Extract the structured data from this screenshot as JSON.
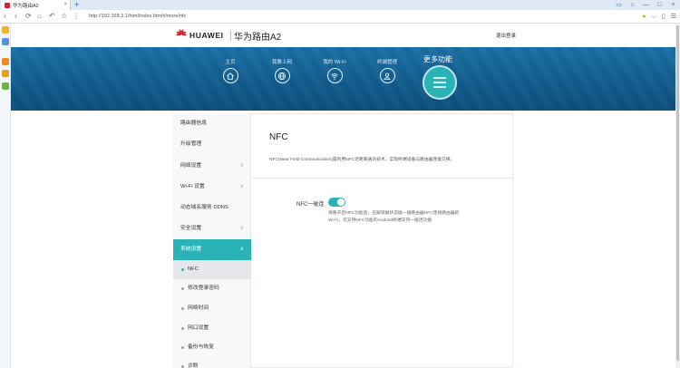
{
  "browser": {
    "tab_title": "华为路由A2",
    "tab_close": "×",
    "new_tab": "+",
    "url": "http://192.168.3.1/html/index.html#/more/nfc",
    "nav_back": "‹",
    "nav_forward": "›",
    "nav_refresh": "⟳",
    "nav_home": "⌂",
    "nav_undo": "↶",
    "nav_star": "☆",
    "nav_menu": "⋮",
    "win_controls": [
      "▭",
      "⌂",
      "—",
      "□",
      "×"
    ],
    "addr_icons": [
      "●",
      "⌵",
      "▯",
      "☰"
    ]
  },
  "header": {
    "brand": "HUAWEI",
    "model": "华为路由A2",
    "logout": "退出登录"
  },
  "nav": {
    "items": [
      {
        "label": "主页",
        "icon": "home-icon"
      },
      {
        "label": "我要上网",
        "icon": "globe-icon"
      },
      {
        "label": "我的 Wi-Fi",
        "icon": "wifi-icon"
      },
      {
        "label": "终端管理",
        "icon": "user-icon"
      }
    ],
    "more_label": "更多功能",
    "accent_color": "#2ab3b7"
  },
  "menu": {
    "items": [
      {
        "label": "路由器信息"
      },
      {
        "label": "升级管理"
      },
      {
        "label": "网络设置",
        "chevron": "∨"
      },
      {
        "label": "Wi-Fi 设置",
        "chevron": "∨"
      },
      {
        "label": "动态域名服务 DDNS"
      },
      {
        "label": "安全设置",
        "chevron": "∨"
      },
      {
        "label": "系统设置",
        "chevron": "∧"
      }
    ],
    "subitems": [
      {
        "label": "NFC"
      },
      {
        "label": "修改登录密码"
      },
      {
        "label": "网络时间"
      },
      {
        "label": "网口设置"
      },
      {
        "label": "备份与恢复"
      },
      {
        "label": "诊断"
      }
    ]
  },
  "content": {
    "title": "NFC",
    "description": "NFC(Near Field Communication)是利用NFC近距离通讯技术，实现终端设备与路由器连接交换。",
    "field_label": "NFC一碰连",
    "toggle_on": true,
    "help_line1": "将路开启NFC功能后，在解锁屏状态碰一碰路由器NFC连接路由器的",
    "help_line2": "Wi-Fi，仅支持NFC功能的Android终端支持一碰连功能"
  }
}
